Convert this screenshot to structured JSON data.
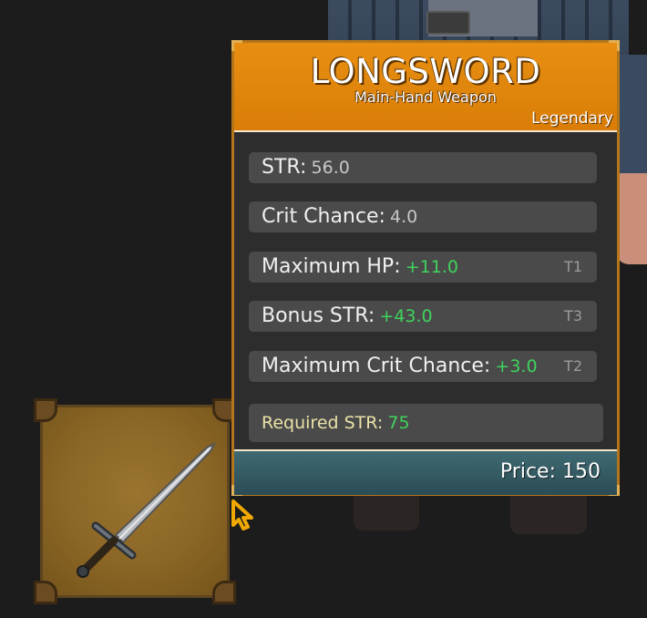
{
  "item": {
    "name": "LONGSWORD",
    "type": "Main-Hand Weapon",
    "rarity": "Legendary",
    "icon": "longsword-icon"
  },
  "stats": [
    {
      "name": "STR:",
      "value": "56.0",
      "tier": ""
    },
    {
      "name": "Crit Chance:",
      "value": "4.0",
      "tier": ""
    },
    {
      "name": "Maximum HP:",
      "value": "+11.0",
      "tier": "T1"
    },
    {
      "name": "Bonus STR:",
      "value": "+43.0",
      "tier": "T3"
    },
    {
      "name": "Maximum Crit Chance:",
      "value": "+3.0",
      "tier": "T2"
    }
  ],
  "requirement": {
    "name": "Required STR:",
    "value": "75"
  },
  "price": {
    "text": "Price: 150"
  },
  "colors": {
    "header_orange": "#e88f12",
    "border_gold": "#b5761a",
    "bonus_green": "#3fd35d",
    "footer_teal": "#3f6a72",
    "background": "#1c1c1c"
  }
}
